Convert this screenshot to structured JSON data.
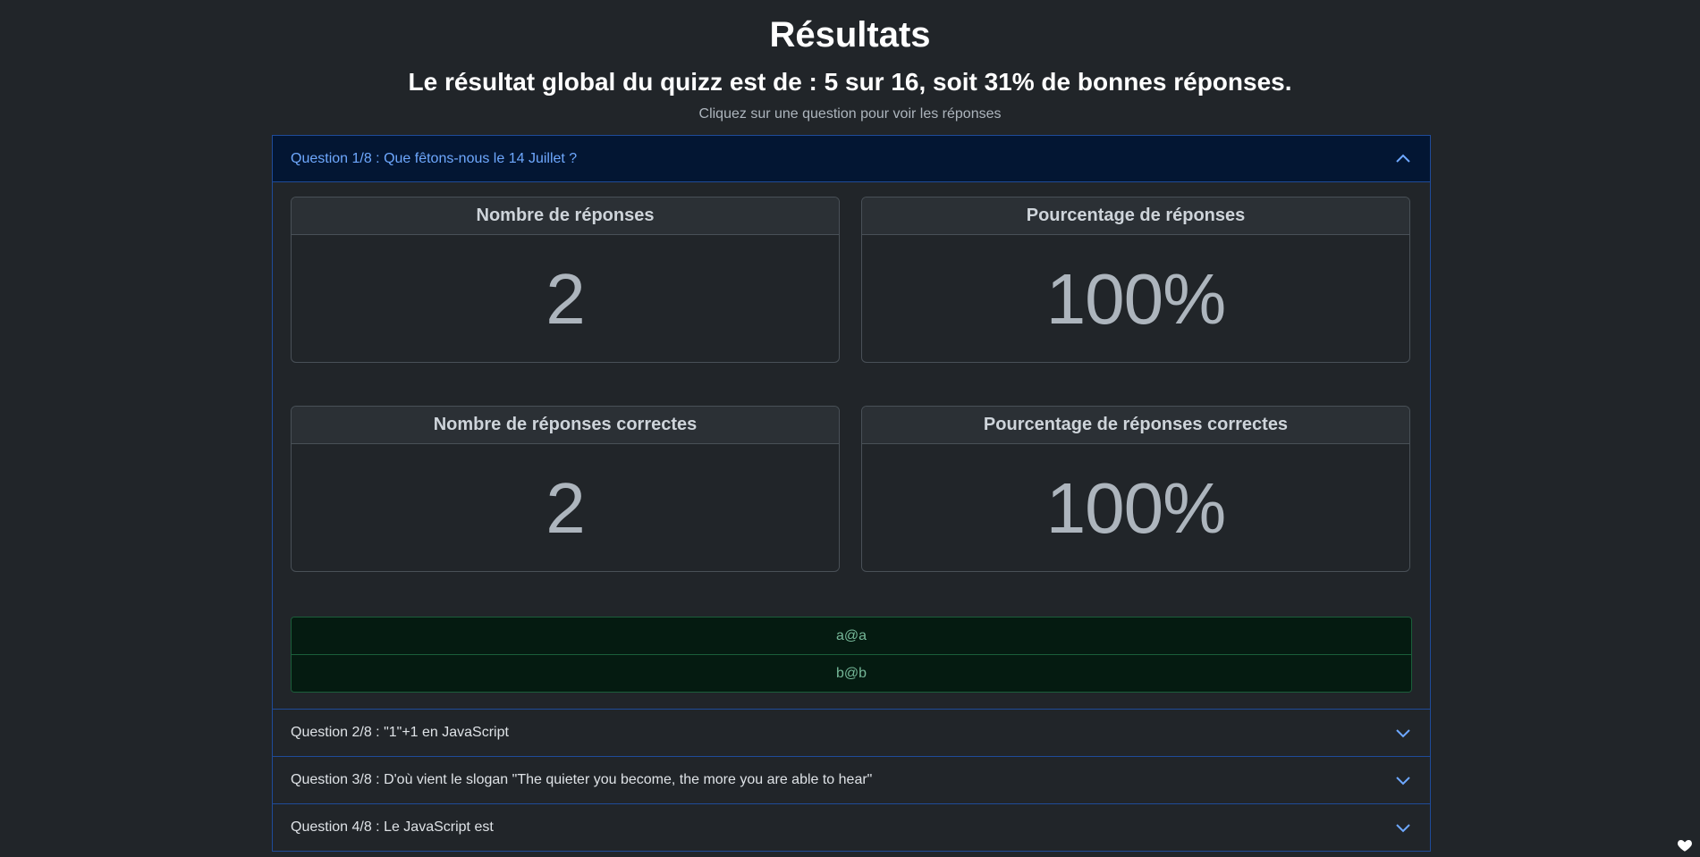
{
  "header": {
    "title": "Résultats",
    "summary": "Le résultat global du quizz est de : 5 sur 16, soit 31% de bonnes réponses.",
    "hint": "Cliquez sur une question pour voir les réponses"
  },
  "questions": [
    {
      "label": "Question 1/8 : Que fêtons-nous le 14 Juillet ?",
      "expanded": true,
      "stats": {
        "responses_label": "Nombre de réponses",
        "responses_value": "2",
        "responses_pct_label": "Pourcentage de réponses",
        "responses_pct_value": "100%",
        "correct_label": "Nombre de réponses correctes",
        "correct_value": "2",
        "correct_pct_label": "Pourcentage de réponses correctes",
        "correct_pct_value": "100%"
      },
      "answers": [
        "a@a",
        "b@b"
      ]
    },
    {
      "label": "Question 2/8 : \"1\"+1 en JavaScript",
      "expanded": false
    },
    {
      "label": "Question 3/8 : D'où vient le slogan \"The quieter you become, the more you are able to hear\"",
      "expanded": false
    },
    {
      "label": "Question 4/8 : Le JavaScript est",
      "expanded": false
    }
  ],
  "icons": {
    "expanded": "chevron-up-icon",
    "collapsed": "chevron-down-icon",
    "corner": "heart-icon"
  },
  "colors": {
    "background": "#212529",
    "accent": "#6ea8fe",
    "accordion_border": "#1f4b99",
    "answer_background": "#051b11",
    "answer_text": "#75b798"
  }
}
